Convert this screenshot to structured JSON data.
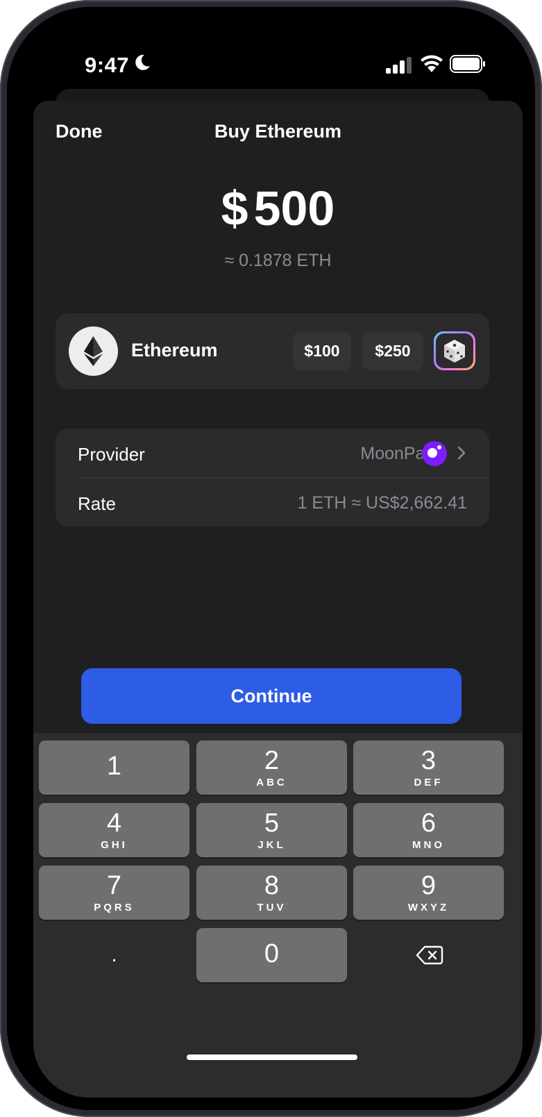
{
  "status_bar": {
    "time": "9:47"
  },
  "header": {
    "done_label": "Done",
    "title": "Buy Ethereum"
  },
  "amount": {
    "currency_symbol": "$",
    "value": "500",
    "approx_crypto": "≈ 0.1878 ETH"
  },
  "asset": {
    "name": "Ethereum",
    "quick_amounts": [
      "$100",
      "$250"
    ],
    "icon": "ethereum-icon"
  },
  "details": {
    "provider_label": "Provider",
    "provider_value": "MoonPay",
    "rate_label": "Rate",
    "rate_value": "1 ETH ≈ US$2,662.41"
  },
  "continue_label": "Continue",
  "keypad": {
    "keys": [
      {
        "num": "1",
        "letters": ""
      },
      {
        "num": "2",
        "letters": "ABC"
      },
      {
        "num": "3",
        "letters": "DEF"
      },
      {
        "num": "4",
        "letters": "GHI"
      },
      {
        "num": "5",
        "letters": "JKL"
      },
      {
        "num": "6",
        "letters": "MNO"
      },
      {
        "num": "7",
        "letters": "PQRS"
      },
      {
        "num": "8",
        "letters": "TUV"
      },
      {
        "num": "9",
        "letters": "WXYZ"
      },
      {
        "num": "0",
        "letters": ""
      }
    ],
    "decimal": "."
  },
  "colors": {
    "accent": "#2d5ce6",
    "sheet": "#1f1f21",
    "card": "#2b2b2e",
    "moonpay": "#7d1dff"
  }
}
